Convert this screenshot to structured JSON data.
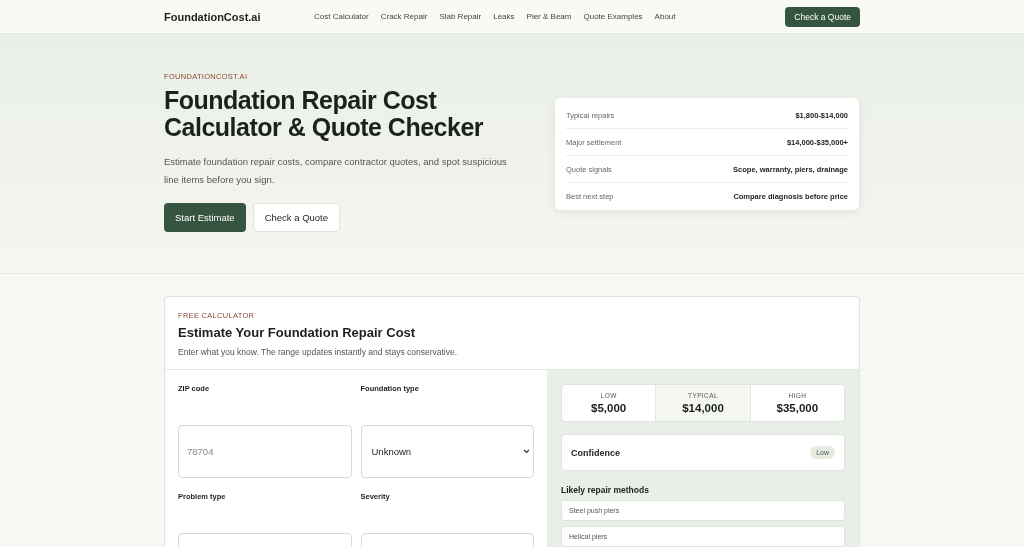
{
  "header": {
    "logo": "FoundationCost.ai",
    "nav": [
      "Cost Calculator",
      "Crack Repair",
      "Slab Repair",
      "Leaks",
      "Pier & Beam",
      "Quote Examples",
      "About"
    ],
    "cta": "Check a Quote"
  },
  "hero": {
    "eyebrow": "FOUNDATIONCOST.AI",
    "title": "Foundation Repair Cost Calculator & Quote Checker",
    "lead": "Estimate foundation repair costs, compare contractor quotes, and spot suspicious line items before you sign.",
    "primary_button": "Start Estimate",
    "secondary_button": "Check a Quote",
    "facts": [
      {
        "label": "Typical repairs",
        "value": "$1,800-$14,000"
      },
      {
        "label": "Major settlement",
        "value": "$14,000-$35,000+"
      },
      {
        "label": "Quote signals",
        "value": "Scope, warranty, piers, drainage"
      },
      {
        "label": "Best next step",
        "value": "Compare diagnosis before price"
      }
    ]
  },
  "calculator": {
    "eyebrow": "FREE CALCULATOR",
    "title": "Estimate Your Foundation Repair Cost",
    "subtitle": "Enter what you know. The range updates instantly and stays conservative.",
    "fields": [
      {
        "label": "ZIP code",
        "kind": "input",
        "placeholder": "78704"
      },
      {
        "label": "Foundation type",
        "kind": "select",
        "value": "Unknown"
      },
      {
        "label": "Problem type",
        "kind": "select"
      },
      {
        "label": "Severity",
        "kind": "select"
      }
    ],
    "range": [
      {
        "label": "LOW",
        "value": "$5,000",
        "selected": false
      },
      {
        "label": "TYPICAL",
        "value": "$14,000",
        "selected": true
      },
      {
        "label": "HIGH",
        "value": "$35,000",
        "selected": false
      }
    ],
    "confidence": {
      "label": "Confidence",
      "value": "Low"
    },
    "methods_title": "Likely repair methods",
    "methods": [
      "Steel push piers",
      "Helical piers"
    ]
  }
}
